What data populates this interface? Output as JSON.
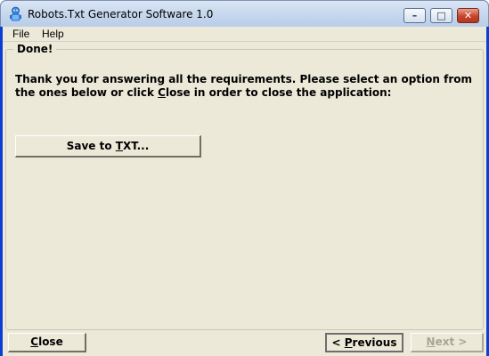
{
  "window": {
    "title": "Robots.Txt Generator Software 1.0",
    "icon": "robot-app-icon",
    "controls": {
      "minimize": "–",
      "maximize": "□",
      "close": "✕"
    }
  },
  "menu": {
    "items": [
      {
        "label": "File"
      },
      {
        "label": "Help"
      }
    ]
  },
  "group": {
    "title": "Done!",
    "message_part1": "Thank you for answering all the requirements. Please select an option from the ones below or click ",
    "message_close_accel": "C",
    "message_close_rest": "lose",
    "message_part2": " in order to close the application:",
    "save_button": {
      "pre": "Save to ",
      "accel": "T",
      "post": "XT..."
    }
  },
  "footer": {
    "close": {
      "accel": "C",
      "rest": "lose"
    },
    "previous": {
      "pre": "< ",
      "accel": "P",
      "rest": "revious"
    },
    "next": {
      "accel": "N",
      "rest": "ext >"
    }
  },
  "colors": {
    "face": "#ece9d8",
    "titlebar": "#c9d9ee",
    "disabled_text": "#a7a595"
  }
}
